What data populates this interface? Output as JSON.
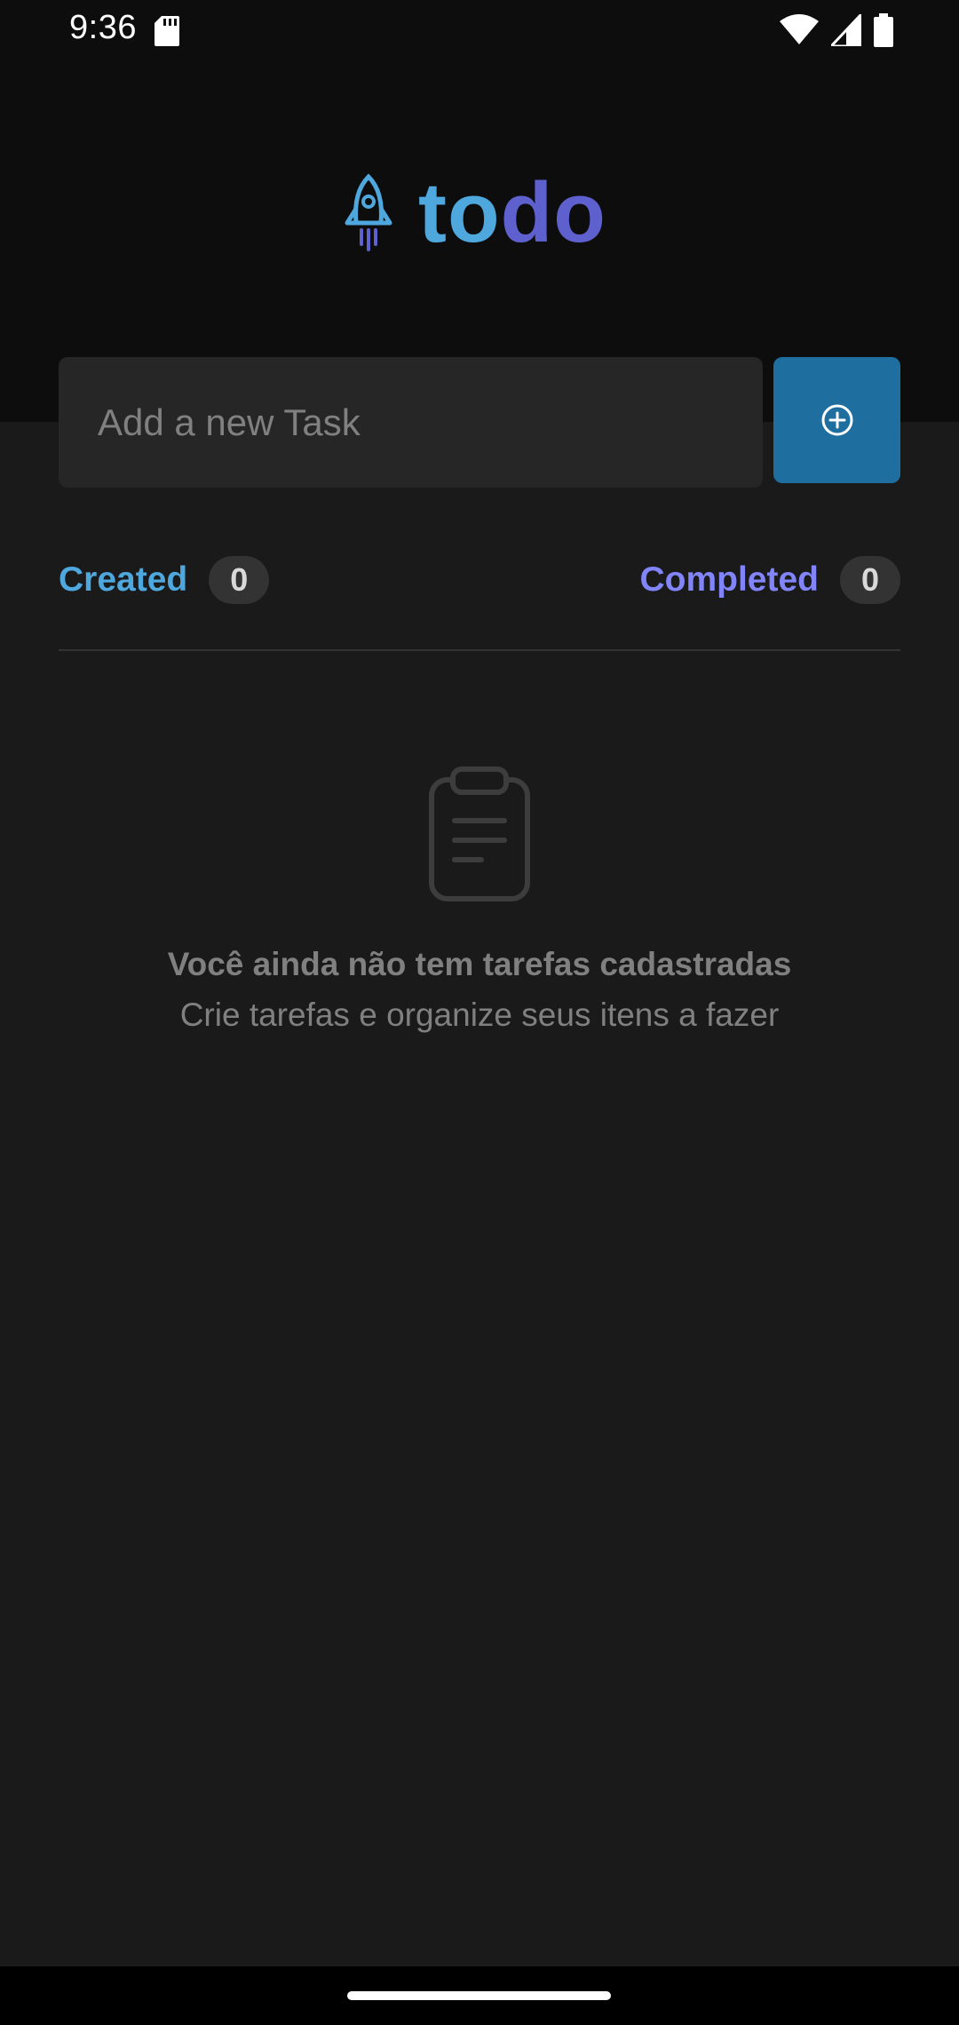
{
  "status_bar": {
    "time": "9:36",
    "icons": [
      "sd-card-icon",
      "wifi-icon",
      "cell-signal-icon",
      "battery-icon"
    ]
  },
  "header": {
    "logo_icon": "rocket-icon",
    "logo_part1": "to",
    "logo_part2": "do",
    "colors": {
      "logo_blue": "#4ea8de",
      "logo_purple": "#5e60ce",
      "background": "#0d0d0d"
    }
  },
  "new_task": {
    "placeholder": "Add a new Task",
    "value": "",
    "add_button_icon": "plus-circle-icon",
    "add_button_color": "#1e6f9f"
  },
  "counters": {
    "created_label": "Created",
    "created_count": "0",
    "completed_label": "Completed",
    "completed_count": "0",
    "created_color": "#4ea8de",
    "completed_color": "#8284fa"
  },
  "empty_state": {
    "icon": "clipboard-icon",
    "title": "Você ainda não tem tarefas cadastradas",
    "subtitle": "Crie tarefas e organize seus itens a fazer"
  }
}
